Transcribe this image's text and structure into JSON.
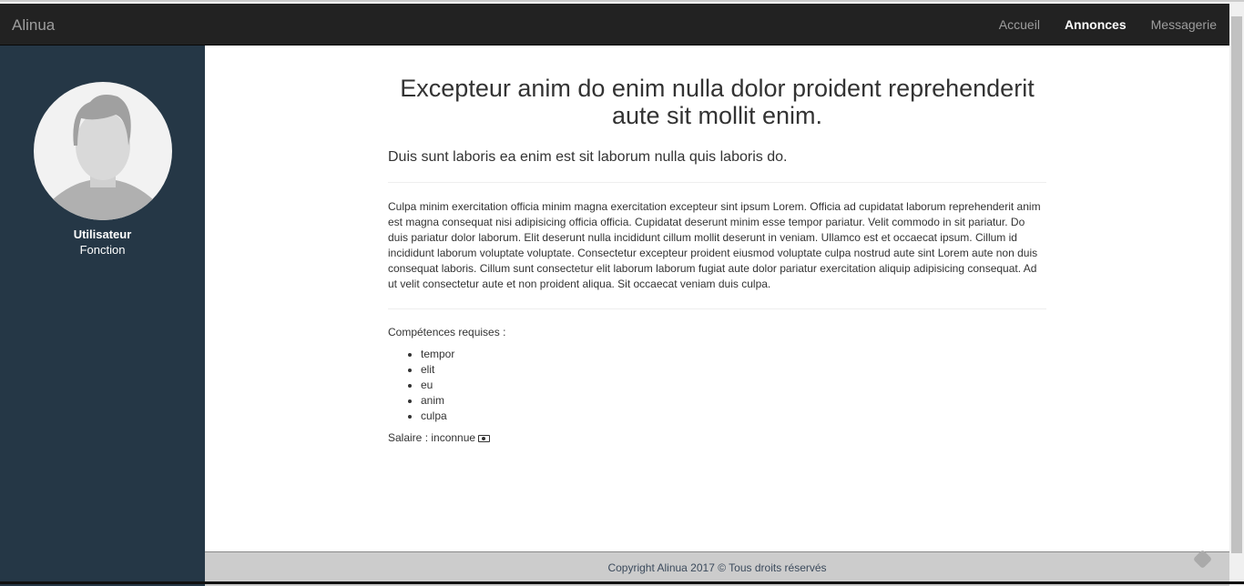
{
  "nav": {
    "brand": "Alinua",
    "links": [
      {
        "label": "Accueil"
      },
      {
        "label": "Annonces",
        "active": true
      },
      {
        "label": "Messagerie"
      }
    ]
  },
  "sidebar": {
    "name": "Utilisateur",
    "function": "Fonction"
  },
  "main": {
    "title": "Excepteur anim do enim nulla dolor proident reprehenderit aute sit mollit enim.",
    "lead": "Duis sunt laboris ea enim est sit laborum nulla quis laboris do.",
    "description": "Culpa minim exercitation officia minim magna exercitation excepteur sint ipsum Lorem. Officia ad cupidatat laborum reprehenderit anim est magna consequat nisi adipisicing officia officia. Cupidatat deserunt minim esse tempor pariatur. Velit commodo in sit pariatur. Do duis pariatur dolor laborum. Elit deserunt nulla incididunt cillum mollit deserunt in veniam. Ullamco est et occaecat ipsum. Cillum id incididunt laborum voluptate voluptate. Consectetur excepteur proident eiusmod voluptate culpa nostrud aute sint Lorem aute non duis consequat laboris. Cillum sunt consectetur elit laborum laborum fugiat aute dolor pariatur exercitation aliquip adipisicing consequat. Ad ut velit consectetur aute et non proident aliqua. Sit occaecat veniam duis culpa.",
    "skills_label": "Compétences requises :",
    "skills": [
      "tempor",
      "elit",
      "eu",
      "anim",
      "culpa"
    ],
    "salary": "Salaire : inconnue"
  },
  "footer": {
    "text": "Copyright Alinua 2017 © Tous droits réservés"
  }
}
